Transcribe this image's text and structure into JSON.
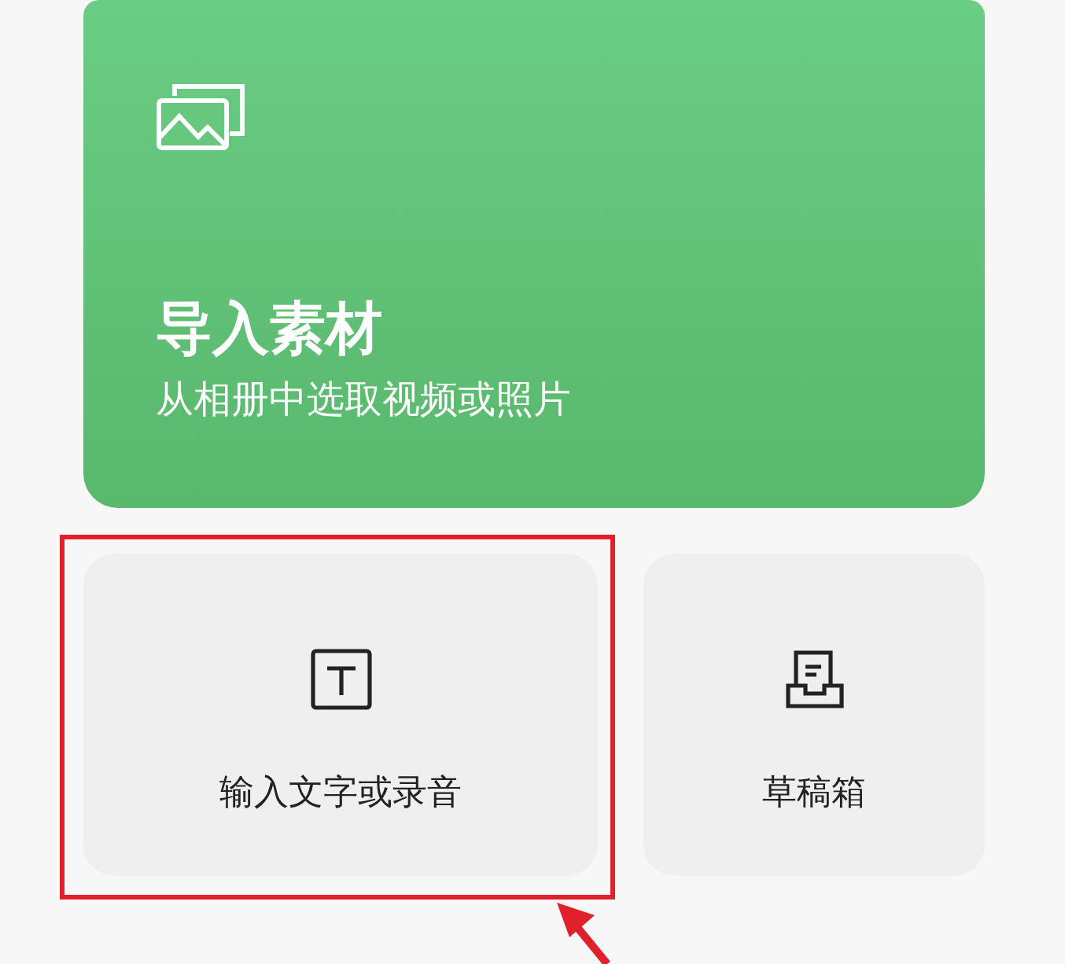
{
  "import_card": {
    "title": "导入素材",
    "subtitle": "从相册中选取视频或照片"
  },
  "actions": [
    {
      "kind": "text",
      "label": "输入文字或录音",
      "highlighted": true
    },
    {
      "kind": "drafts",
      "label": "草稿箱",
      "highlighted": false
    }
  ]
}
